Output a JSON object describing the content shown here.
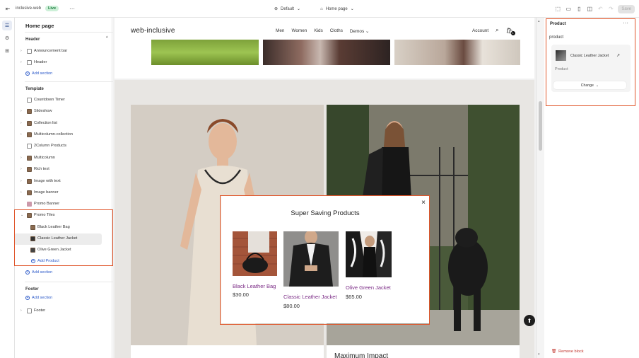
{
  "topbar": {
    "theme_name": "inclusive-web",
    "live_badge": "Live",
    "more": "···",
    "template_select": "Default",
    "page_select": "Home page",
    "save_label": "Save"
  },
  "sidebar": {
    "title": "Home page",
    "header_group": "Header",
    "header_items": [
      "Announcement bar",
      "Header"
    ],
    "header_add": "Add section",
    "template_group": "Template",
    "template_items": [
      "Countdown Timer",
      "Slideshow",
      "Collection list",
      "Multicolumn-collection",
      "2Column Products",
      "Multicolumn",
      "Rich text",
      "Image with text",
      "Image banner",
      "Promo Banner",
      "Promo Tiles"
    ],
    "promo_blocks": [
      "Black Leather Bag",
      "Classic Leather Jacket",
      "Olive Green Jacket"
    ],
    "add_product": "Add Product",
    "template_add": "Add section",
    "footer_group": "Footer",
    "footer_add": "Add section",
    "footer_items": [
      "Footer"
    ]
  },
  "store": {
    "logo": "web-inclusive",
    "nav": [
      "Men",
      "Women",
      "Kids",
      "Cloths",
      "Demos"
    ],
    "account": "Account",
    "cart_count": "1",
    "tile_heading": "Maximum Impact"
  },
  "modal": {
    "title": "Super Saving Products",
    "close": "×",
    "products": [
      {
        "name": "Black Leather Bag",
        "price": "$30.00"
      },
      {
        "name": "Classic Leather Jacket",
        "price": "$80.00"
      },
      {
        "name": "Olive Green Jacket",
        "price": "$65.00"
      }
    ]
  },
  "panel": {
    "title": "Product",
    "more": "···",
    "label": "product",
    "product_name": "Classic Leather Jacket",
    "product_type": "Product",
    "change_label": "Change",
    "remove_label": "Remove block"
  },
  "colors": {
    "highlight": "#e0552a",
    "link_blue": "#2a58c8",
    "product_name": "#7a2a85",
    "remove_red": "#c0322a"
  }
}
